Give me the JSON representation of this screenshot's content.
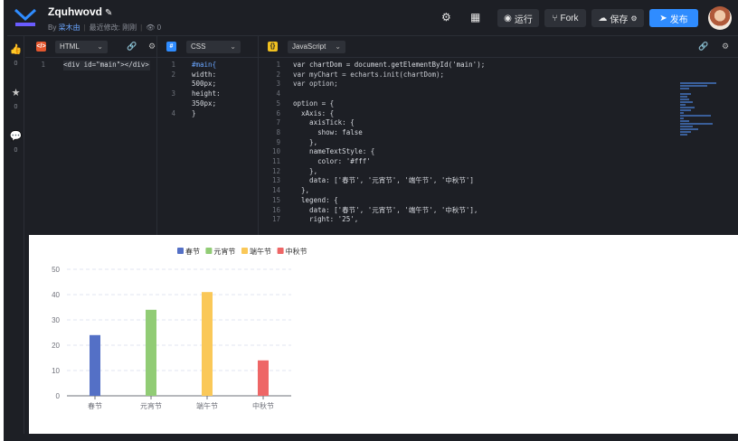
{
  "header": {
    "title": "Zquhwovd",
    "author_prefix": "By",
    "author": "梁木由",
    "modified": "最近修改: 刚刚",
    "views": "0",
    "run_label": "运行",
    "fork_label": "Fork",
    "save_label": "保存",
    "publish_label": "发布"
  },
  "rail": {
    "likes": "0",
    "stars": "0",
    "comments": "0"
  },
  "panes": {
    "html": {
      "lang": "HTML"
    },
    "css": {
      "lang": "CSS"
    },
    "js": {
      "lang": "JavaScript"
    }
  },
  "code": {
    "html_line1": "<div id=\"main\"></div>",
    "css_lines": [
      "#main{",
      "  width: 500px;",
      "  height: 350px;",
      "}"
    ],
    "js_lines": [
      "var chartDom = document.getElementById('main');",
      "var myChart = echarts.init(chartDom);",
      "var option;",
      "",
      "option = {",
      "  xAxis: {",
      "    axisTick: {",
      "      show: false",
      "    },",
      "    nameTextStyle: {",
      "      color: '#fff'",
      "    },",
      "    data: ['春节', '元宵节', '端午节', '中秋节']",
      "  },",
      "  legend: {",
      "    data: ['春节', '元宵节', '端午节', '中秋节'],",
      "    right: '25',"
    ]
  },
  "colors": {
    "bg": "#1d1f25",
    "accent": "#2f8cff",
    "series": [
      "#5470c6",
      "#91cc75",
      "#fac858",
      "#ee6666"
    ]
  },
  "chart_data": {
    "type": "bar",
    "categories": [
      "春节",
      "元宵节",
      "端午节",
      "中秋节"
    ],
    "values": [
      24,
      34,
      41,
      14
    ],
    "legend": [
      "春节",
      "元宵节",
      "端午节",
      "中秋节"
    ],
    "ylim": [
      0,
      50
    ],
    "yticks": [
      0,
      10,
      20,
      30,
      40,
      50
    ],
    "grid": true,
    "legend_position": "top"
  }
}
